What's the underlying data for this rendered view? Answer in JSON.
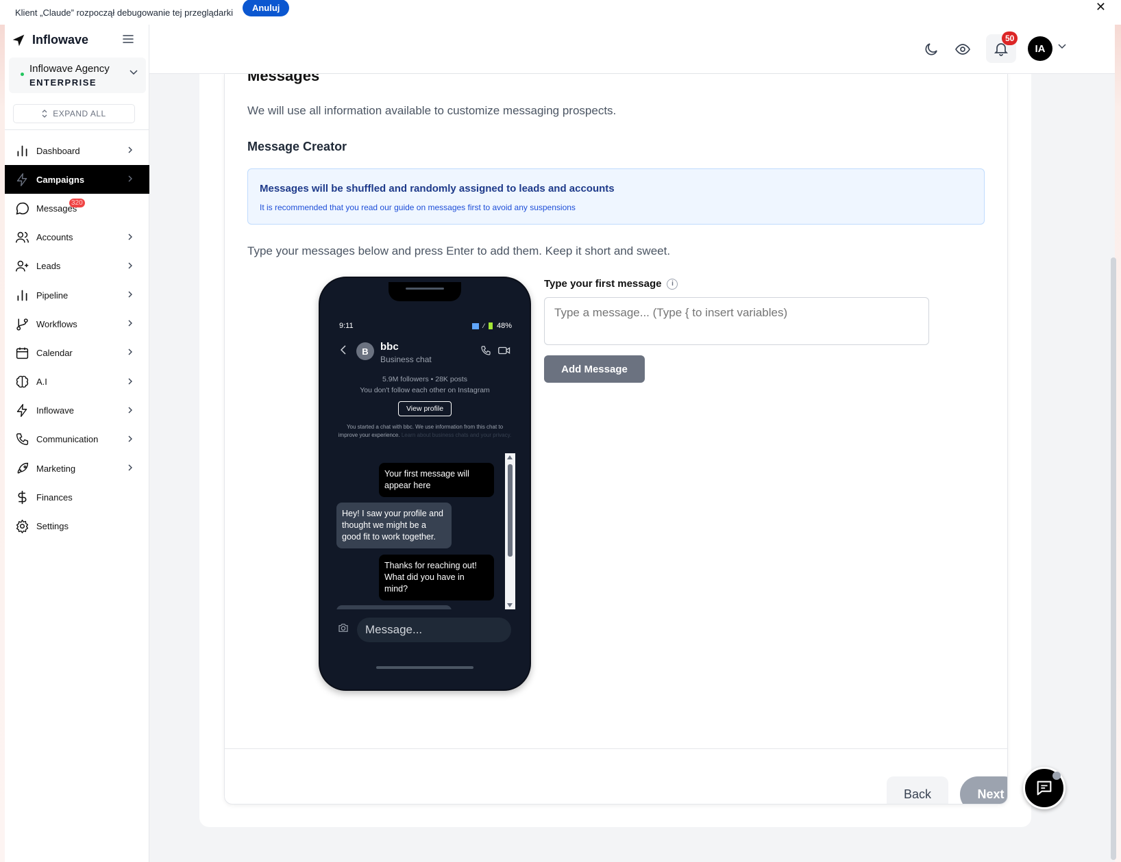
{
  "debug_bar": {
    "message": "Klient „Claude” rozpoczął debugowanie tej przeglądarki",
    "cancel_label": "Anuluj",
    "close_glyph": "✕"
  },
  "sidebar": {
    "brand": "Inflowave",
    "org_name": "Inflowave Agency",
    "org_tier": "ENTERPRISE",
    "expand_all": "EXPAND ALL",
    "items": [
      {
        "label": "Dashboard",
        "icon": "bar-chart-icon",
        "chevron": true
      },
      {
        "label": "Campaigns",
        "icon": "lightning-icon",
        "chevron": true,
        "active": true
      },
      {
        "label": "Messages",
        "icon": "chat-bubble-icon",
        "chevron": false,
        "badge": "320"
      },
      {
        "label": "Accounts",
        "icon": "users-icon",
        "chevron": true
      },
      {
        "label": "Leads",
        "icon": "user-plus-icon",
        "chevron": true
      },
      {
        "label": "Pipeline",
        "icon": "bar-chart-icon",
        "chevron": true
      },
      {
        "label": "Workflows",
        "icon": "git-branch-icon",
        "chevron": true
      },
      {
        "label": "Calendar",
        "icon": "calendar-icon",
        "chevron": true
      },
      {
        "label": "A.I",
        "icon": "brain-icon",
        "chevron": true
      },
      {
        "label": "Inflowave",
        "icon": "lightning-icon",
        "chevron": true
      },
      {
        "label": "Communication",
        "icon": "phone-icon",
        "chevron": true
      },
      {
        "label": "Marketing",
        "icon": "rocket-icon",
        "chevron": true
      },
      {
        "label": "Finances",
        "icon": "dollar-icon",
        "chevron": false
      },
      {
        "label": "Settings",
        "icon": "gear-icon",
        "chevron": false
      }
    ]
  },
  "header": {
    "notifications_count": "50",
    "avatar_initials": "IA"
  },
  "main": {
    "section_title": "Messages",
    "section_desc": "We will use all information available to customize messaging prospects.",
    "creator_title": "Message Creator",
    "info_title": "Messages will be shuffled and randomly assigned to leads and accounts",
    "info_text": "It is recommended that you read our guide on messages first to avoid any suspensions",
    "instructions": "Type your messages below and press Enter to add them. Keep it short and sweet.",
    "first_message_label": "Type your first message",
    "first_message_placeholder": "Type a message... (Type { to insert variables)",
    "add_message": "Add Message",
    "back": "Back",
    "next": "Next"
  },
  "phone": {
    "time": "9:11",
    "battery": "48%",
    "contact_initial": "B",
    "contact_name": "bbc",
    "contact_sub": "Business chat",
    "stats": "5.9M followers • 28K posts",
    "follow_note": "You don't follow each other on Instagram",
    "view_profile": "View profile",
    "disclaimer": "You started a chat with bbc. We use information from this chat to improve your experience.",
    "disclaimer_link": "Learn about business chats and your privacy.",
    "messages": [
      {
        "dir": "out",
        "text": "Your first message will appear here"
      },
      {
        "dir": "in",
        "text": "Hey! I saw your profile and thought we might be a good fit to work together."
      },
      {
        "dir": "out",
        "text": "Thanks for reaching out! What did you have in mind?"
      }
    ],
    "input_placeholder": "Message..."
  }
}
